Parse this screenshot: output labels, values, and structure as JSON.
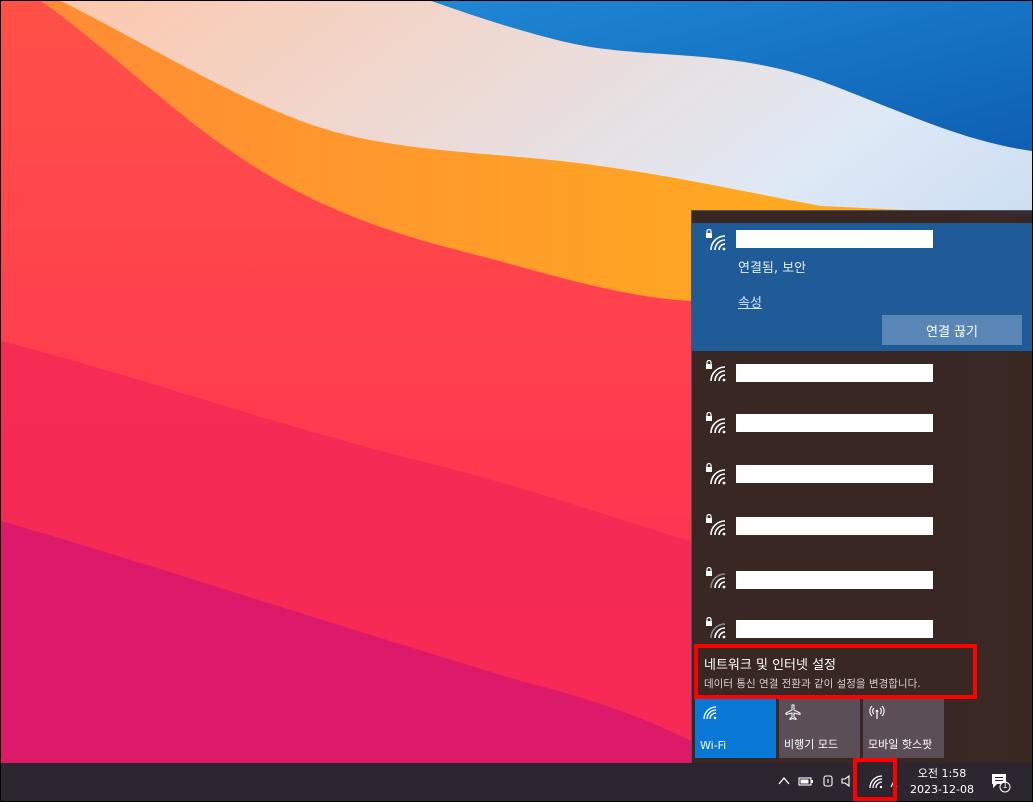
{
  "flyout": {
    "connected_status": "연결됨, 보안",
    "properties_link": "속성",
    "disconnect_label": "연결 끊기",
    "networks_count_visible": 6,
    "settings_title": "네트워크 및 인터넷 설정",
    "settings_desc": "데이터 통신 연결 전환과 같이 설정을 변경합니다."
  },
  "quick_actions": [
    {
      "label": "Wi-Fi",
      "icon": "wifi-icon",
      "active": true
    },
    {
      "label": "비행기 모드",
      "icon": "airplane-icon",
      "active": false
    },
    {
      "label": "모바일 핫스팟",
      "icon": "hotspot-icon",
      "active": false
    }
  ],
  "taskbar": {
    "time": "오전 1:58",
    "date": "2023-12-08",
    "notification_count": "1"
  },
  "colors": {
    "accent": "#0a78d7",
    "connected_bg": "#1f5c97",
    "highlight": "#ff0000"
  }
}
